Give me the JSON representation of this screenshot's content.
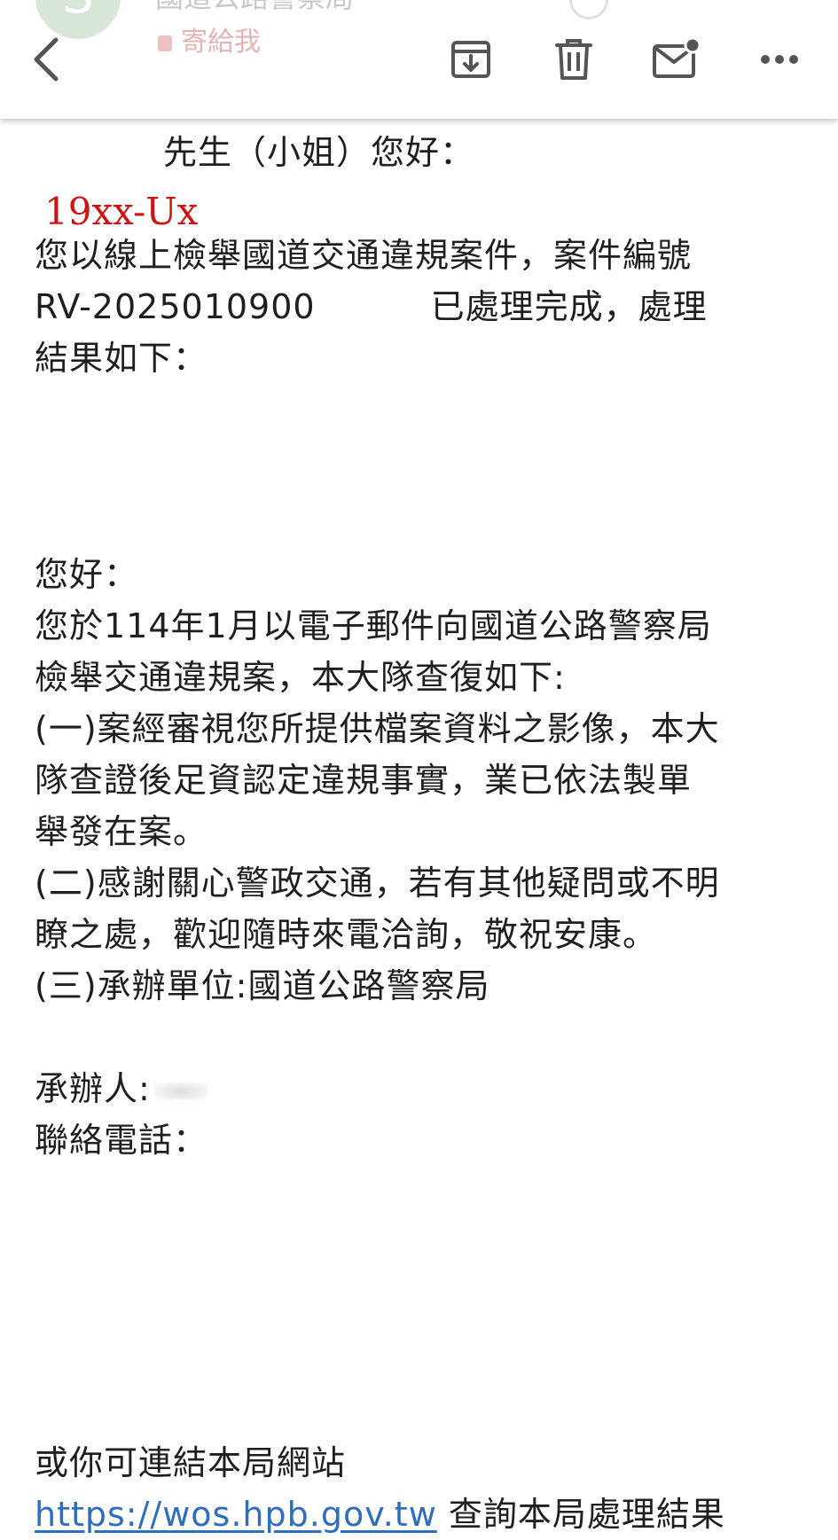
{
  "header": {
    "sender_ghost": "國道公路警察局",
    "recipient_ghost": "寄給我",
    "avatar_letter": "S",
    "icons": [
      "back-chevron-icon",
      "archive-icon",
      "trash-icon",
      "mark-unread-icon",
      "more-icon"
    ]
  },
  "email": {
    "salutation": "先生（小姐）您好：",
    "stamp_text": "19xx-Ux",
    "intro_line1": "您以線上檢舉國道交通違規案件，案件編號",
    "case_number": "RV-2025010900",
    "intro_line2_tail": "已處理完成，處理",
    "intro_line3": "結果如下：",
    "greeting": "您好：",
    "reply_line1": "您於114年1月以電子郵件向國道公路警察局",
    "reply_line2": "檢舉交通違規案，本大隊查復如下:",
    "item1_line1": "(一)案經審視您所提供檔案資料之影像，本大",
    "item1_line2": "隊查證後足資認定違規事實，業已依法製單",
    "item1_line3": "舉發在案。",
    "item2_line1": "(二)感謝關心警政交通，若有其他疑問或不明",
    "item2_line2": "瞭之處，歡迎隨時來電洽詢，敬祝安康。",
    "item3_line1": "(三)承辦單位:國道公路警察局",
    "handler_label": "承辦人:",
    "phone_label": "聯絡電話：",
    "website_prompt": "或你可連結本局網站",
    "website_url": "https://wos.hpb.gov.tw",
    "website_tail": " 查詢本局處理結果"
  },
  "colors": {
    "link": "#2f6dbd",
    "stamp": "#cc1414",
    "icon": "#555555",
    "text": "#1f1f1f"
  }
}
